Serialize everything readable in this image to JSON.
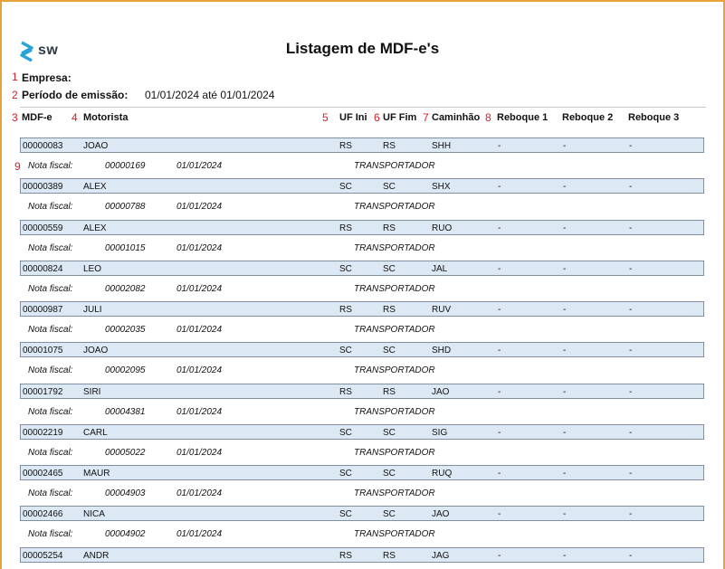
{
  "report": {
    "title": "Listagem de MDF-e's",
    "logo_text": "sw",
    "empresa_label": "Empresa:",
    "periodo_label": "Período de emissão:",
    "periodo_value": "01/01/2024 até 01/01/2024"
  },
  "markers": [
    "1",
    "2",
    "3",
    "4",
    "5",
    "6",
    "7",
    "8",
    "9"
  ],
  "columns": {
    "mdfe": "MDF-e",
    "motorista": "Motorista",
    "uf_ini": "UF Ini",
    "uf_fim": "UF Fim",
    "caminhao": "Caminhão",
    "reboque1": "Reboque 1",
    "reboque2": "Reboque 2",
    "reboque3": "Reboque 3"
  },
  "note_label": "Nota fiscal:",
  "rows": [
    {
      "mdfe": "00000083",
      "motorista": "JOAO",
      "uf_ini": "RS",
      "uf_fim": "RS",
      "caminhao": "SHH",
      "reboque1": "-",
      "reboque2": "-",
      "reboque3": "-",
      "nf": "00000169",
      "nf_date": "01/01/2024",
      "nf_role": "TRANSPORTADOR"
    },
    {
      "mdfe": "00000389",
      "motorista": "ALEX",
      "uf_ini": "SC",
      "uf_fim": "SC",
      "caminhao": "SHX",
      "reboque1": "-",
      "reboque2": "-",
      "reboque3": "-",
      "nf": "00000788",
      "nf_date": "01/01/2024",
      "nf_role": "TRANSPORTADOR"
    },
    {
      "mdfe": "00000559",
      "motorista": "ALEX",
      "uf_ini": "RS",
      "uf_fim": "RS",
      "caminhao": "RUO",
      "reboque1": "-",
      "reboque2": "-",
      "reboque3": "-",
      "nf": "00001015",
      "nf_date": "01/01/2024",
      "nf_role": "TRANSPORTADOR"
    },
    {
      "mdfe": "00000824",
      "motorista": "LEO",
      "uf_ini": "SC",
      "uf_fim": "SC",
      "caminhao": "JAL",
      "reboque1": "-",
      "reboque2": "-",
      "reboque3": "-",
      "nf": "00002082",
      "nf_date": "01/01/2024",
      "nf_role": "TRANSPORTADOR"
    },
    {
      "mdfe": "00000987",
      "motorista": "JULI",
      "uf_ini": "RS",
      "uf_fim": "RS",
      "caminhao": "RUV",
      "reboque1": "-",
      "reboque2": "-",
      "reboque3": "-",
      "nf": "00002035",
      "nf_date": "01/01/2024",
      "nf_role": "TRANSPORTADOR"
    },
    {
      "mdfe": "00001075",
      "motorista": "JOAO",
      "uf_ini": "SC",
      "uf_fim": "SC",
      "caminhao": "SHD",
      "reboque1": "-",
      "reboque2": "-",
      "reboque3": "-",
      "nf": "00002095",
      "nf_date": "01/01/2024",
      "nf_role": "TRANSPORTADOR"
    },
    {
      "mdfe": "00001792",
      "motorista": "SIRI",
      "uf_ini": "RS",
      "uf_fim": "RS",
      "caminhao": "JAO",
      "reboque1": "-",
      "reboque2": "-",
      "reboque3": "-",
      "nf": "00004381",
      "nf_date": "01/01/2024",
      "nf_role": "TRANSPORTADOR"
    },
    {
      "mdfe": "00002219",
      "motorista": "CARL",
      "uf_ini": "SC",
      "uf_fim": "SC",
      "caminhao": "SIG",
      "reboque1": "-",
      "reboque2": "-",
      "reboque3": "-",
      "nf": "00005022",
      "nf_date": "01/01/2024",
      "nf_role": "TRANSPORTADOR"
    },
    {
      "mdfe": "00002465",
      "motorista": "MAUR",
      "uf_ini": "SC",
      "uf_fim": "SC",
      "caminhao": "RUQ",
      "reboque1": "-",
      "reboque2": "-",
      "reboque3": "-",
      "nf": "00004903",
      "nf_date": "01/01/2024",
      "nf_role": "TRANSPORTADOR"
    },
    {
      "mdfe": "00002466",
      "motorista": "NICA",
      "uf_ini": "SC",
      "uf_fim": "SC",
      "caminhao": "JAO",
      "reboque1": "-",
      "reboque2": "-",
      "reboque3": "-",
      "nf": "00004902",
      "nf_date": "01/01/2024",
      "nf_role": "TRANSPORTADOR"
    },
    {
      "mdfe": "00005254",
      "motorista": "ANDR",
      "uf_ini": "RS",
      "uf_fim": "RS",
      "caminhao": "JAG",
      "reboque1": "-",
      "reboque2": "-",
      "reboque3": "-"
    }
  ]
}
